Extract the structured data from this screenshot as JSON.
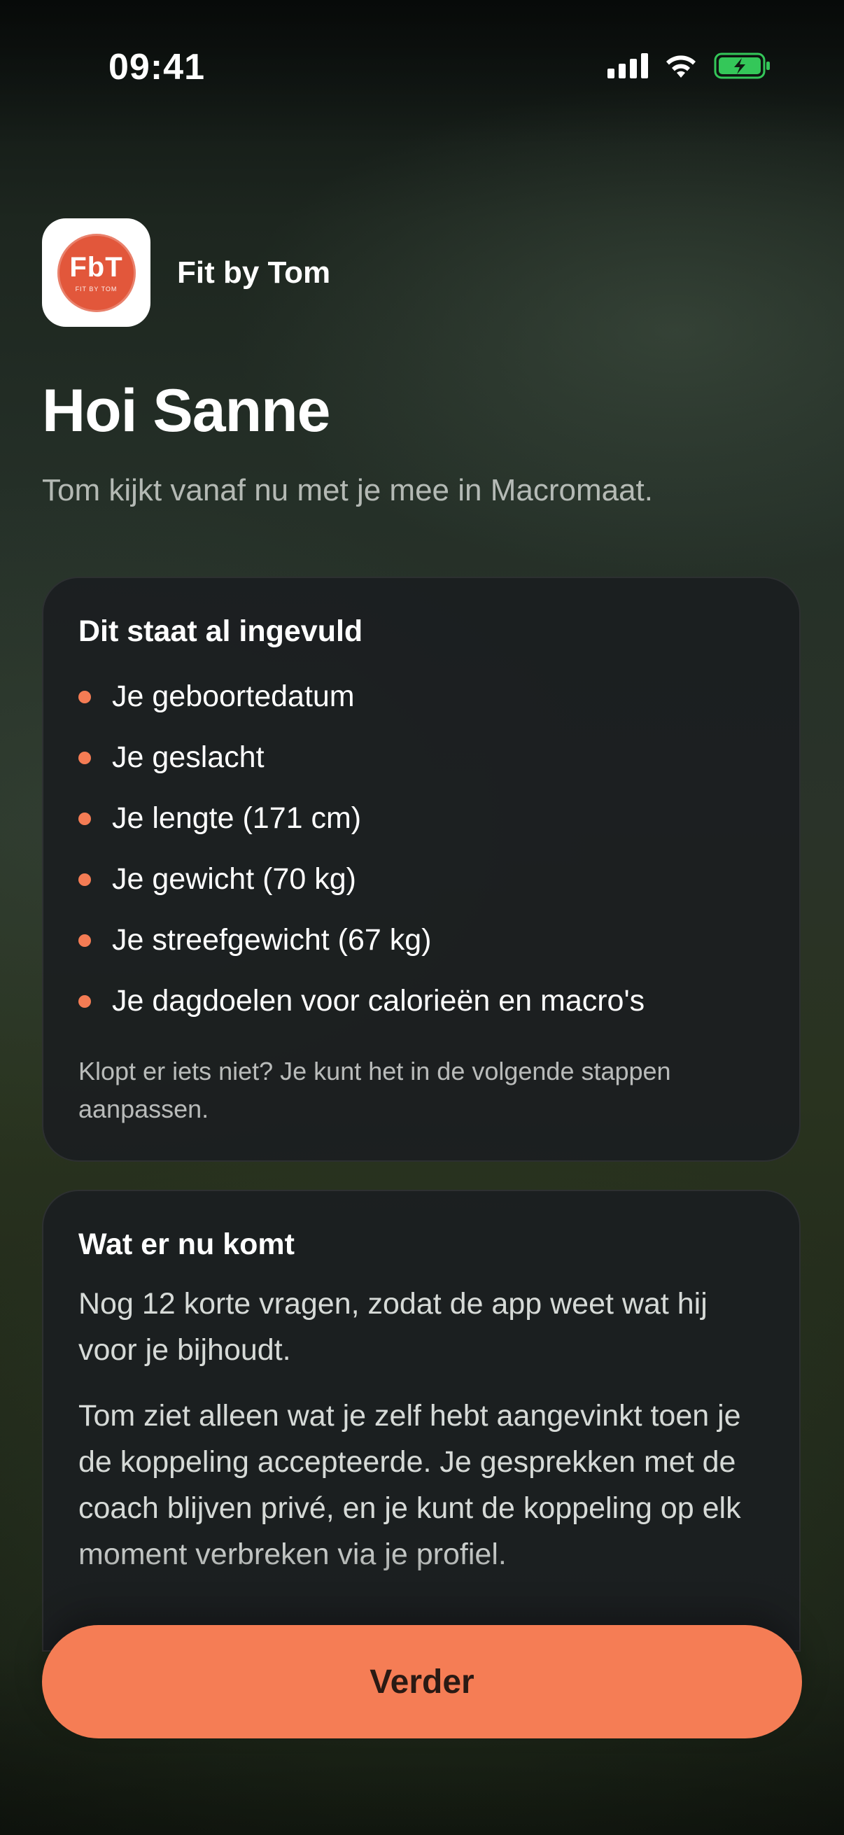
{
  "status_bar": {
    "time": "09:41",
    "icons": [
      "cellular-signal-icon",
      "wifi-icon",
      "battery-charging-icon"
    ]
  },
  "app": {
    "name": "Fit by Tom",
    "logo_text": "FbT",
    "logo_subtext": "FIT BY TOM"
  },
  "greeting": "Hoi Sanne",
  "subtitle": "Tom kijkt vanaf nu met je mee in Macromaat.",
  "prefilled_card": {
    "title": "Dit staat al ingevuld",
    "items": [
      "Je geboortedatum",
      "Je geslacht",
      "Je lengte (171 cm)",
      "Je gewicht (70 kg)",
      "Je streefgewicht (67 kg)",
      "Je dagdoelen voor calorieën en macro's"
    ],
    "note": "Klopt er iets niet? Je kunt het in de volgende stappen aanpassen."
  },
  "next_card": {
    "title": "Wat er nu komt",
    "paragraph_1": "Nog 12 korte vragen, zodat de app weet wat hij voor je bijhoudt.",
    "paragraph_2": "Tom ziet alleen wat je zelf hebt aangevinkt toen je de koppeling accepteerde. Je gesprekken met de coach blijven privé, en je kunt de koppeling op elk moment verbreken via je profiel."
  },
  "primary_button": {
    "label": "Verder"
  },
  "colors": {
    "accent": "#f57d55",
    "bullet": "#f47c54",
    "logo_background": "#e2573b",
    "card_background": "#1b1e20",
    "battery": "#34c759"
  }
}
